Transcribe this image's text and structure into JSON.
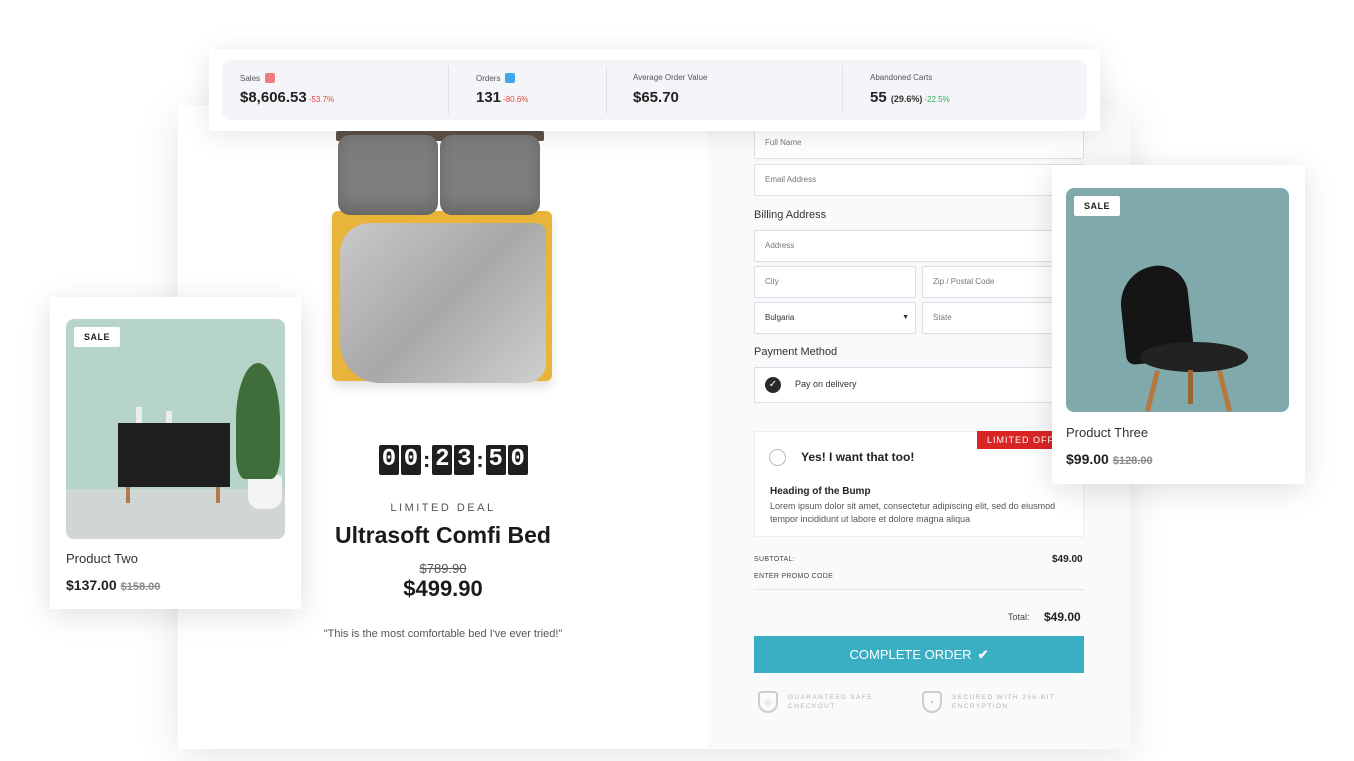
{
  "stats": {
    "sales": {
      "label": "Sales",
      "value": "$8,606.53",
      "change": "-53.7%",
      "swatch_color": "#f07b7b"
    },
    "orders": {
      "label": "Orders",
      "value": "131",
      "change": "-80.6%",
      "swatch_color": "#3fa8e8"
    },
    "aov": {
      "label": "Average Order Value",
      "value": "$65.70"
    },
    "abandoned": {
      "label": "Abandoned Carts",
      "value": "55",
      "share": "(29.6%)",
      "change": "-22.5%"
    }
  },
  "landing": {
    "countdown": [
      "0",
      "0",
      "2",
      "3",
      "5",
      "0"
    ],
    "limited_deal": "LIMITED DEAL",
    "title": "Ultrasoft Comfi Bed",
    "old_price": "$789.90",
    "price": "$499.90",
    "testimonial": "\"This is the most comfortable bed I've ever tried!\""
  },
  "form": {
    "full_name_placeholder": "Full Name",
    "email_placeholder": "Email Address",
    "billing_label": "Billing Address",
    "address_placeholder": "Address",
    "city_placeholder": "City",
    "zip_placeholder": "Zip / Postal Code",
    "country_value": "Bulgaria",
    "state_placeholder": "State",
    "payment_label": "Payment Method",
    "payment_option": "Pay on delivery"
  },
  "bump": {
    "title": "Yes! I want that too!",
    "ribbon": "LIMITED OFFER",
    "heading": "Heading of the Bump",
    "text": "Lorem ipsum dolor sit amet, consectetur adipiscing elit, sed do eiusmod tempor incididunt ut labore et dolore magna aliqua"
  },
  "summary": {
    "subtotal_label": "SUBTOTAL:",
    "subtotal_value": "$49.00",
    "promo_label": "ENTER PROMO CODE",
    "total_label": "Total:",
    "total_value": "$49.00",
    "button_label": "COMPLETE ORDER",
    "trust_1": "GUARANTEED SAFE CHECKOUT",
    "trust_2": "SECURED WITH 256-BIT ENCRYPTION"
  },
  "products": {
    "two": {
      "badge": "SALE",
      "name": "Product Two",
      "price": "$137.00",
      "was": "$158.00"
    },
    "three": {
      "badge": "SALE",
      "name": "Product Three",
      "price": "$99.00",
      "was": "$128.00"
    }
  },
  "colors": {
    "accent": "#3aafc4",
    "ribbon": "#d92424",
    "negative": "#e0473f",
    "positive": "#2faa55"
  }
}
